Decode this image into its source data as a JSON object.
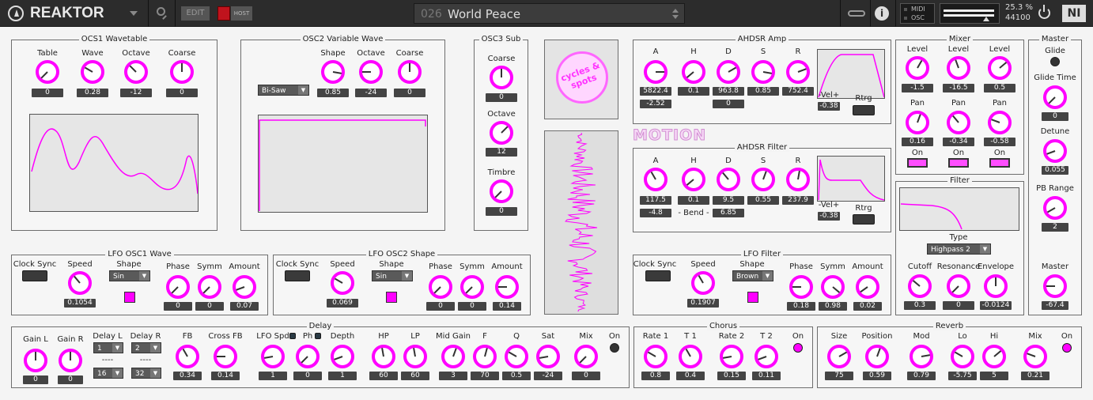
{
  "topbar": {
    "app": "REAKTOR",
    "edit": "EDIT",
    "host": "HOST",
    "preset_num": "026",
    "preset_name": "World Peace",
    "midi": "MIDI",
    "osc": "OSC",
    "cpu": "25.3 %",
    "rate": "44100"
  },
  "colors": {
    "accent": "#ff00ff",
    "bg": "#f4f4f4",
    "dark": "#2c2c2c"
  },
  "titles": {
    "osc1": "OCS1 Wavetable",
    "osc2": "OSC2 Variable Wave",
    "osc3": "OSC3 Sub",
    "amp": "AHDSR Amp",
    "filt": "AHDSR Filter",
    "mixer": "Mixer",
    "filter": "Filter",
    "master": "Master",
    "lfo1": "LFO OSC1 Wave",
    "lfo2": "LFO OSC2 Shape",
    "lfof": "LFO Filter",
    "delay": "Delay",
    "chorus": "Chorus",
    "reverb": "Reverb",
    "motion": "MOTION",
    "logo": "cycles & spots"
  },
  "labels": {
    "table": "Table",
    "wave": "Wave",
    "octave": "Octave",
    "coarse": "Coarse",
    "shape": "Shape",
    "timbre": "Timbre",
    "A": "A",
    "H": "H",
    "D": "D",
    "S": "S",
    "R": "R",
    "vel": "-Vel+",
    "rtrg": "Rtrg",
    "bend": "- Bend -",
    "level": "Level",
    "pan": "Pan",
    "on": "On",
    "type": "Type",
    "cutoff": "Cutoff",
    "resonance": "Resonance",
    "envelope": "Envelope",
    "glide": "Glide",
    "glide_time": "Glide Time",
    "detune": "Detune",
    "pb_range": "PB Range",
    "master": "Master",
    "clock_sync": "Clock Sync",
    "speed": "Speed",
    "phase": "Phase",
    "symm": "Symm",
    "amount": "Amount",
    "gain_l": "Gain L",
    "gain_r": "Gain R",
    "delay_l": "Delay L",
    "delay_r": "Delay R",
    "fb": "FB",
    "cross_fb": "Cross FB",
    "lfo_spd": "LFO Spd",
    "ph": "Ph",
    "depth": "Depth",
    "hp": "HP",
    "lp": "LP",
    "mid_gain": "Mid Gain",
    "f": "F",
    "q": "Q",
    "sat": "Sat",
    "mix": "Mix",
    "rate1": "Rate 1",
    "t1": "T 1",
    "rate2": "Rate 2",
    "t2": "T 2",
    "size": "Size",
    "position": "Position",
    "mod": "Mod",
    "lo": "Lo",
    "hi": "Hi",
    "dash": "----"
  },
  "dropdowns": {
    "osc2_wave": "Bi-Saw",
    "lfo1_shape": "Sin",
    "lfo2_shape": "Sin",
    "lfof_shape": "Brown",
    "filter_type": "Highpass 2",
    "delay_l_top": "1",
    "delay_l_bot": "16",
    "delay_r_top": "2",
    "delay_r_bot": "32"
  },
  "values": {
    "table": "0",
    "wave": "0.28",
    "octave1": "-12",
    "coarse1": "0",
    "shape2": "0.85",
    "octave2": "-24",
    "coarse2": "0",
    "coarse3": "0",
    "octave3": "12",
    "timbre": "0",
    "amp_a": "5822.4",
    "amp_h": "0.1",
    "amp_d": "963.8",
    "amp_s": "0.85",
    "amp_r": "752.4",
    "amp_a2": "-2.52",
    "amp_d2": "0",
    "amp_vel": "-0.38",
    "f_a": "117.5",
    "f_h": "0.1",
    "f_d": "9.5",
    "f_s": "0.55",
    "f_r": "237.9",
    "f_a2": "-4.8",
    "f_d2": "6.85",
    "f_vel": "-0.38",
    "lev1": "-1.5",
    "lev2": "-16.5",
    "lev3": "0.5",
    "pan1": "0.16",
    "pan2": "-0.34",
    "pan3": "-0.58",
    "cutoff": "0.3",
    "resonance": "0",
    "envelope": "-0.0124",
    "glide_time": "0",
    "detune": "0.055",
    "pb_range": "2",
    "master": "-67.4",
    "l1_speed": "0.1054",
    "l1_phase": "0",
    "l1_symm": "0",
    "l1_amount": "0.07",
    "l2_speed": "0.069",
    "l2_phase": "0",
    "l2_symm": "0",
    "l2_amount": "0.14",
    "lf_speed": "0.1907",
    "lf_phase": "0.18",
    "lf_symm": "0.98",
    "lf_amount": "0.02",
    "gain_l": "0",
    "gain_r": "0",
    "fb": "0.34",
    "cross_fb": "0.14",
    "lfo_spd": "1",
    "ph": "0",
    "depth": "1",
    "hp": "60",
    "lp": "60",
    "mid_gain": "3",
    "f": "70",
    "q": "0.5",
    "sat": "-24",
    "dmix": "0",
    "rate1": "0.8",
    "t1": "0.4",
    "rate2": "0.15",
    "t2": "0.11",
    "size": "75",
    "position": "0.59",
    "mod": "0.79",
    "lo": "-5.75",
    "hi": "5",
    "rmix": "0.21"
  }
}
